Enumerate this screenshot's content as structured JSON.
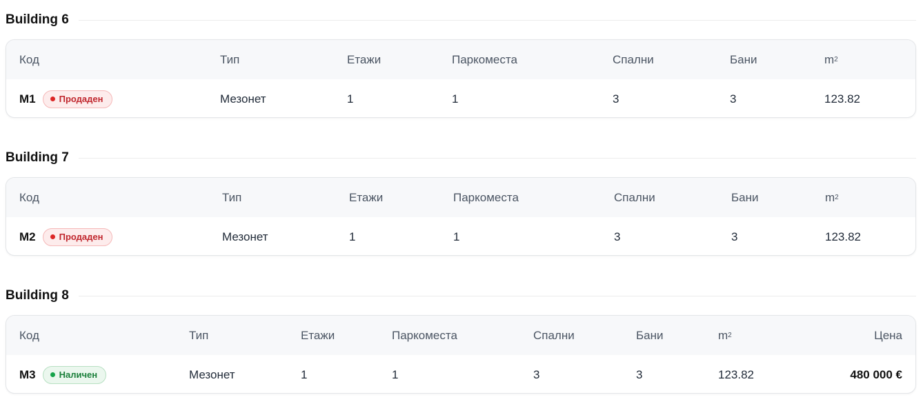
{
  "sections": [
    {
      "title": "Building 6",
      "headers": {
        "code": "Код",
        "type": "Тип",
        "floors": "Етажи",
        "parking": "Паркоместа",
        "bedrooms": "Спални",
        "bathrooms": "Бани",
        "area_unit": "m",
        "area_sup": "2"
      },
      "row": {
        "code": "M1",
        "status": "Продаден",
        "status_kind": "sold",
        "type": "Мезонет",
        "floors": "1",
        "parking": "1",
        "bedrooms": "3",
        "bathrooms": "3",
        "area": "123.82"
      }
    },
    {
      "title": "Building 7",
      "headers": {
        "code": "Код",
        "type": "Тип",
        "floors": "Етажи",
        "parking": "Паркоместа",
        "bedrooms": "Спални",
        "bathrooms": "Бани",
        "area_unit": "m",
        "area_sup": "2"
      },
      "row": {
        "code": "M2",
        "status": "Продаден",
        "status_kind": "sold",
        "type": "Мезонет",
        "floors": "1",
        "parking": "1",
        "bedrooms": "3",
        "bathrooms": "3",
        "area": "123.82"
      }
    },
    {
      "title": "Building 8",
      "headers": {
        "code": "Код",
        "type": "Тип",
        "floors": "Етажи",
        "parking": "Паркоместа",
        "bedrooms": "Спални",
        "bathrooms": "Бани",
        "area_unit": "m",
        "area_sup": "2",
        "price": "Цена"
      },
      "row": {
        "code": "M3",
        "status": "Наличен",
        "status_kind": "available",
        "type": "Мезонет",
        "floors": "1",
        "parking": "1",
        "bedrooms": "3",
        "bathrooms": "3",
        "area": "123.82",
        "price": "480 000 €"
      }
    }
  ],
  "colors": {
    "sold": "#c0262d",
    "available": "#1a7f3a",
    "header_bg": "#f7f8fa"
  }
}
